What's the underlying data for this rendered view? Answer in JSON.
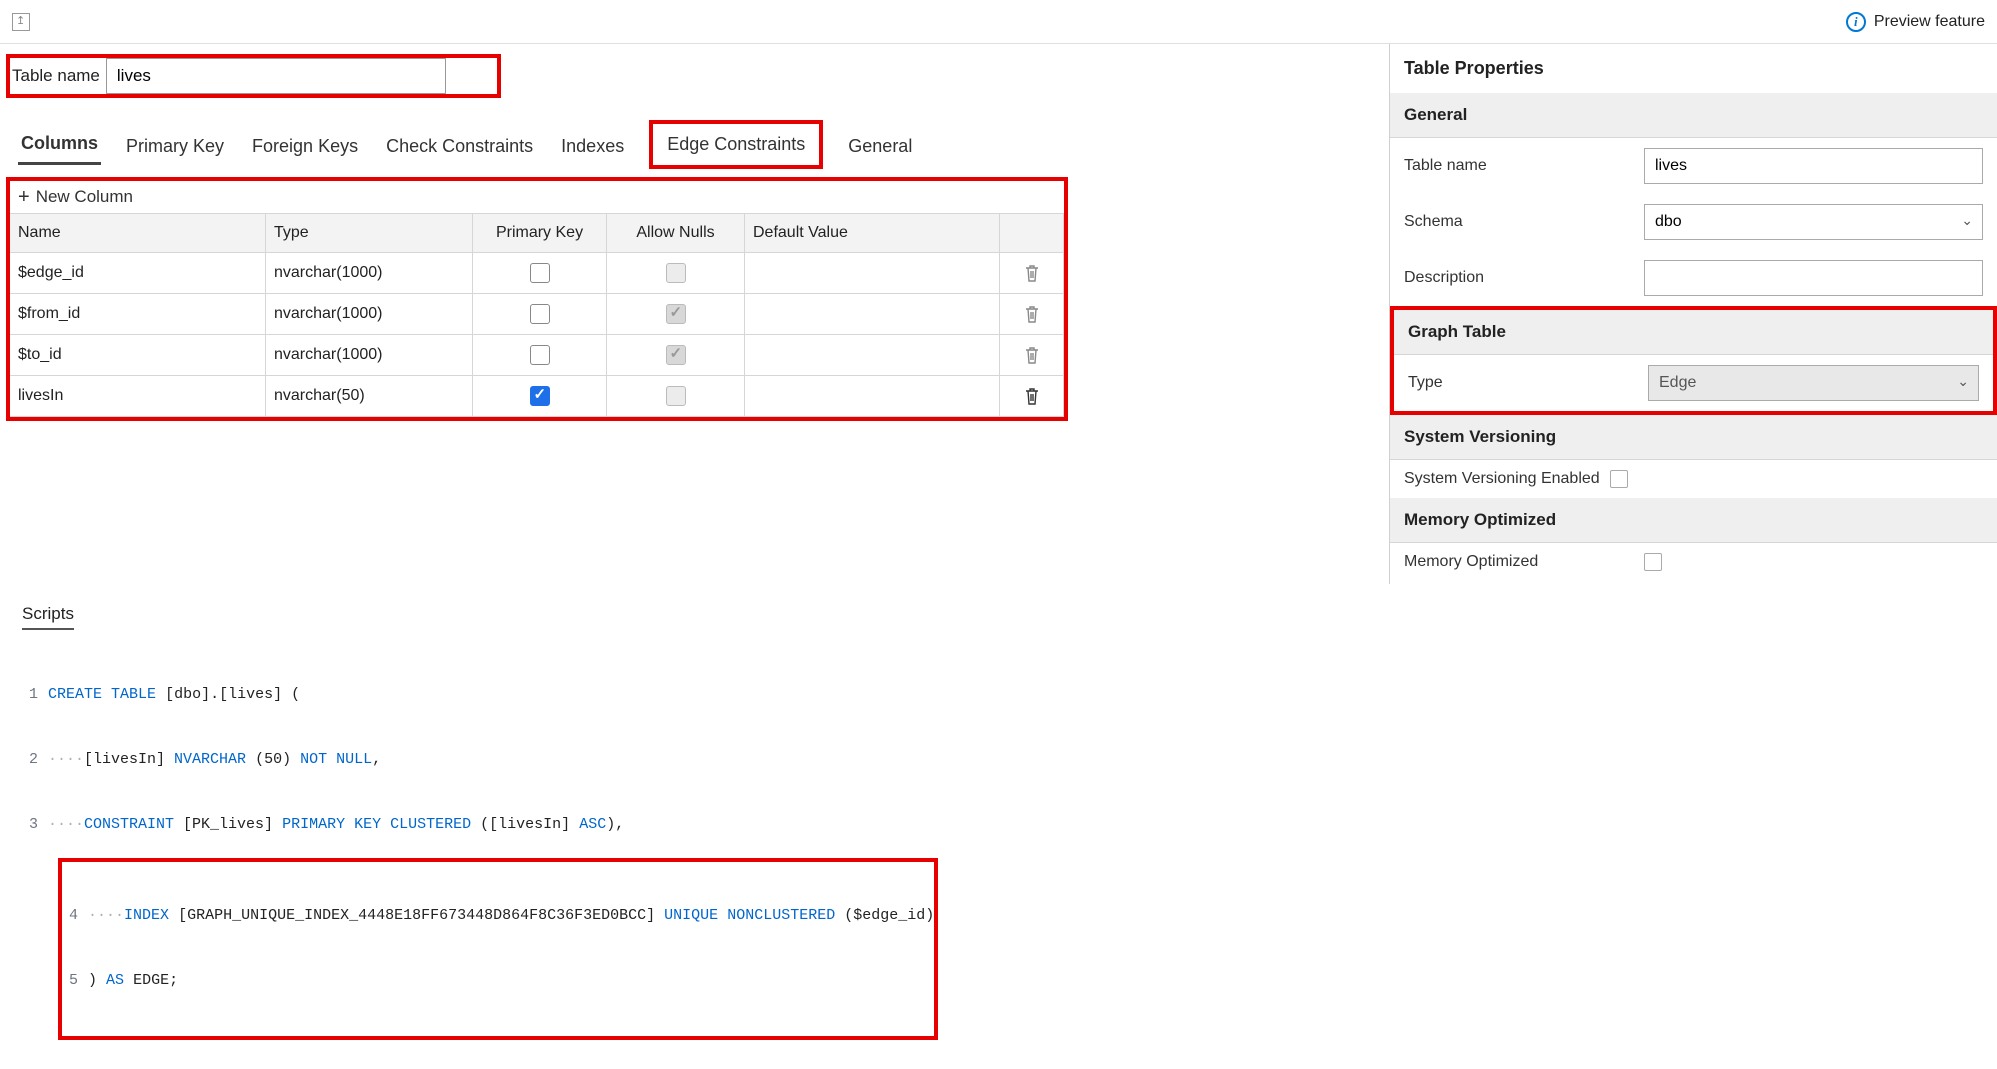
{
  "header": {
    "preview_label": "Preview feature"
  },
  "left": {
    "table_name_label": "Table name",
    "table_name_value": "lives",
    "tabs": {
      "columns": "Columns",
      "primary_key": "Primary Key",
      "foreign_keys": "Foreign Keys",
      "check_constraints": "Check Constraints",
      "indexes": "Indexes",
      "edge_constraints": "Edge Constraints",
      "general": "General"
    },
    "new_column_label": "New Column",
    "column_headers": {
      "name": "Name",
      "type": "Type",
      "pk": "Primary Key",
      "nulls": "Allow Nulls",
      "default": "Default Value"
    },
    "rows": [
      {
        "name": "$edge_id",
        "type": "nvarchar(1000)",
        "pk": false,
        "null_state": "unchecked",
        "trash_active": false
      },
      {
        "name": "$from_id",
        "type": "nvarchar(1000)",
        "pk": false,
        "null_state": "disabled-checked",
        "trash_active": false
      },
      {
        "name": "$to_id",
        "type": "nvarchar(1000)",
        "pk": false,
        "null_state": "disabled-checked",
        "trash_active": false
      },
      {
        "name": "livesIn",
        "type": "nvarchar(50)",
        "pk": true,
        "null_state": "disabled",
        "trash_active": true
      }
    ]
  },
  "right": {
    "title": "Table Properties",
    "sections": {
      "general": "General",
      "graph": "Graph Table",
      "sysver": "System Versioning",
      "memopt": "Memory Optimized"
    },
    "labels": {
      "table_name": "Table name",
      "schema": "Schema",
      "description": "Description",
      "type": "Type",
      "sysver_enabled": "System Versioning Enabled",
      "memopt": "Memory Optimized"
    },
    "values": {
      "table_name": "lives",
      "schema": "dbo",
      "description": "",
      "type": "Edge"
    }
  },
  "scripts": {
    "title": "Scripts",
    "lines": {
      "l1_num": "1",
      "l2_num": "2",
      "l3_num": "3",
      "l4_num": "4",
      "l5_num": "5",
      "l1_a": "CREATE",
      "l1_b": "TABLE",
      "l1_c": "[dbo].[lives] (",
      "l2_a": "[livesIn]",
      "l2_b": "NVARCHAR",
      "l2_c": "(",
      "l2_d": "50",
      "l2_e": ")",
      "l2_f": "NOT",
      "l2_g": "NULL",
      "l2_h": ",",
      "l3_a": "CONSTRAINT",
      "l3_b": "[PK_lives]",
      "l3_c": "PRIMARY",
      "l3_d": "KEY",
      "l3_e": "CLUSTERED",
      "l3_f": "([livesIn]",
      "l3_g": "ASC",
      "l3_h": "),",
      "l4_a": "INDEX",
      "l4_b": "[GRAPH_UNIQUE_INDEX_4448E18FF673448D864F8C36F3ED0BCC]",
      "l4_c": "UNIQUE",
      "l4_d": "NONCLUSTERED",
      "l4_e": "($edge_id)",
      "l5_a": ")",
      "l5_b": "AS",
      "l5_c": "EDGE;",
      "dots": "····"
    }
  }
}
